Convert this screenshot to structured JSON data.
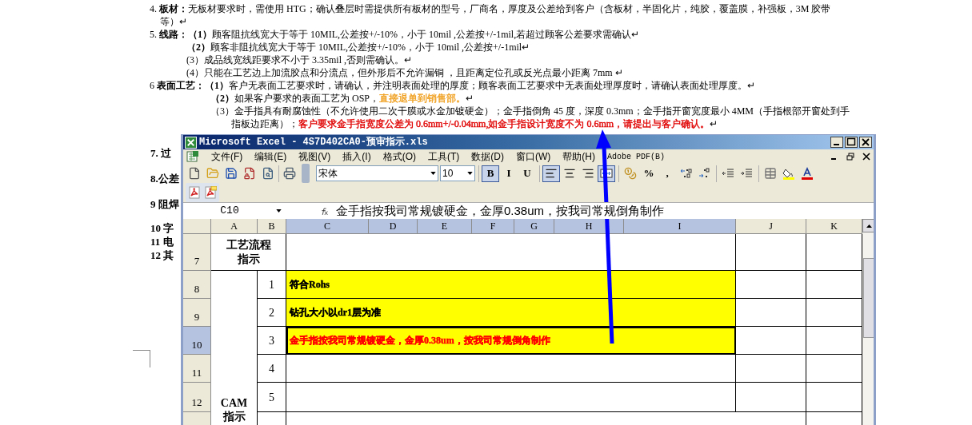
{
  "document": {
    "lines": [
      {
        "kind": "heading",
        "segments": [
          {
            "text": "4. **板材：**无板材要求时，需使用 HTG；确认叠层时需提供所有板材的型号，厂商名，厚度及公差给到客户（含板材，半固化片，纯胶，覆盖膜，补强板，3M 胶带"
          }
        ]
      },
      {
        "kind": "cont",
        "segments": [
          {
            "text": "等）↵"
          }
        ]
      },
      {
        "kind": "heading",
        "segments": [
          {
            "text": "5. **线路：（1）**顾客阻抗线宽大于等于 10MIL,公差按+/-10%，小于 10mil ,公差按+/-1mil,若超过顾客公差要求需确认↵"
          }
        ]
      },
      {
        "kind": "sub",
        "segments": [
          {
            "text": "**（2）**顾客非阻抗线宽大于等于 10MIL,公差按+/-10%，小于 10mil ,公差按+/-1mil↵"
          }
        ]
      },
      {
        "kind": "sub",
        "segments": [
          {
            "text": "(3）成品线宽线距要求不小于 3.35mil ,否则需确认。↵"
          }
        ]
      },
      {
        "kind": "sub",
        "segments": [
          {
            "text": "(4）只能在工艺边上加流胶点和分流点，但外形后不允许漏铜 ，且距离定位孔或反光点最小距离 7mm ↵"
          }
        ]
      },
      {
        "kind": "heading",
        "segments": [
          {
            "text": "6 **表面工艺：（1）**客户无表面工艺要求时，请确认，并注明表面处理的厚度；顾客表面工艺要求中无表面处理厚度时，请确认表面处理厚度。↵"
          }
        ]
      },
      {
        "kind": "sub2",
        "segments": [
          {
            "text": "**（2）**如果客户要求的表面工艺为 OSP，"
          },
          {
            "text": "直接退单到销售部。",
            "color": "#f0a020"
          },
          {
            "text": "↵"
          }
        ]
      },
      {
        "kind": "sub2",
        "segments": [
          {
            "text": "（3）金手指具有耐腐蚀性（不允许使用二次干膜或水金加镀硬金）；金手指倒角 45 度，深度 0.3mm；金手指开窗宽度最小 4MM（手指根部开窗处到手"
          }
        ]
      },
      {
        "kind": "sub3",
        "segments": [
          {
            "text": "指板边距离）；"
          },
          {
            "text": "客户要求金手指宽度公差为 0.6mm+/-0.04mm,如金手指设计宽度不为 0.6mm，请提出与客户确认。",
            "color": "#e00000"
          },
          {
            "text": "↵"
          }
        ]
      }
    ],
    "side_items": [
      "7. 过",
      "8.公差",
      "9 阻焊",
      "10 字",
      "11 电",
      "12 其"
    ]
  },
  "excel": {
    "title": "Microsoft Excel - 4S7D402CA0-预审指示.xls",
    "menu": [
      "文件(F)",
      "编辑(E)",
      "视图(V)",
      "插入(I)",
      "格式(O)",
      "工具(T)",
      "数据(D)",
      "窗口(W)",
      "帮助(H)",
      "Adobe PDF(B)"
    ],
    "font": "宋体",
    "font_size": "10",
    "toolbar_groups": [
      {
        "items": [
          {
            "kind": "new",
            "pressed": false
          },
          {
            "kind": "open",
            "pressed": false
          },
          {
            "kind": "save",
            "pressed": false
          },
          {
            "kind": "permission",
            "pressed": false
          },
          {
            "kind": "preview",
            "pressed": false
          }
        ]
      },
      {
        "items": [
          {
            "kind": "print",
            "pressed": false
          }
        ]
      },
      {
        "items": [
          {
            "kind": "text",
            "label": "B",
            "pressed": true
          },
          {
            "kind": "text",
            "label": "I",
            "pressed": false
          },
          {
            "kind": "text",
            "label": "U",
            "pressed": false
          }
        ]
      },
      {
        "items": [
          {
            "kind": "align_left",
            "pressed": true
          },
          {
            "kind": "align_center",
            "pressed": false
          },
          {
            "kind": "align_right",
            "pressed": false
          },
          {
            "kind": "merge",
            "pressed": true
          }
        ]
      },
      {
        "items": [
          {
            "kind": "currency",
            "pressed": false
          },
          {
            "kind": "text",
            "label": "%",
            "pressed": false
          },
          {
            "kind": "text",
            "label": ",",
            "pressed": false
          },
          {
            "kind": "inc_decimal",
            "pressed": false
          },
          {
            "kind": "dec_decimal",
            "pressed": false
          }
        ]
      },
      {
        "items": [
          {
            "kind": "outdent",
            "pressed": false
          },
          {
            "kind": "indent",
            "pressed": false
          }
        ]
      },
      {
        "items": [
          {
            "kind": "borders",
            "pressed": false
          },
          {
            "kind": "fill_color",
            "pressed": false
          },
          {
            "kind": "font_color",
            "pressed": false
          }
        ]
      }
    ],
    "name_box": "C10",
    "formula": "金手指按我司常规镀硬金，金厚0.38um，按我司常规倒角制作",
    "columns": [
      {
        "label": "A",
        "selected": false
      },
      {
        "label": "B",
        "selected": false
      },
      {
        "label": "C",
        "selected": true
      },
      {
        "label": "D",
        "selected": true
      },
      {
        "label": "E",
        "selected": true
      },
      {
        "label": "F",
        "selected": true
      },
      {
        "label": "G",
        "selected": true
      },
      {
        "label": "H",
        "selected": true
      },
      {
        "label": "I",
        "selected": true
      },
      {
        "label": "J",
        "selected": false
      },
      {
        "label": "K",
        "selected": false
      }
    ],
    "rows": [
      {
        "label": "7",
        "selected": false
      },
      {
        "label": "8",
        "selected": false
      },
      {
        "label": "9",
        "selected": false
      },
      {
        "label": "10",
        "selected": true
      },
      {
        "label": "11",
        "selected": false
      },
      {
        "label": "12",
        "selected": false
      }
    ],
    "process_label": "工艺流程指示",
    "cam_label": "CAM指示",
    "items": [
      {
        "number": "1",
        "text": "符合Rohs",
        "color": "#000000",
        "highlighted": true,
        "selected": false
      },
      {
        "number": "2",
        "text": "钻孔大小以dr1层为准",
        "color": "#000000",
        "highlighted": true,
        "selected": false
      },
      {
        "number": "3",
        "text": "金手指按我司常规镀硬金，金厚0.38um，按我司常规倒角制作",
        "color": "#ff0000",
        "highlighted": true,
        "selected": true
      },
      {
        "number": "4",
        "highlighted": false,
        "selected": false
      },
      {
        "number": "5",
        "highlighted": false,
        "selected": false
      }
    ]
  }
}
